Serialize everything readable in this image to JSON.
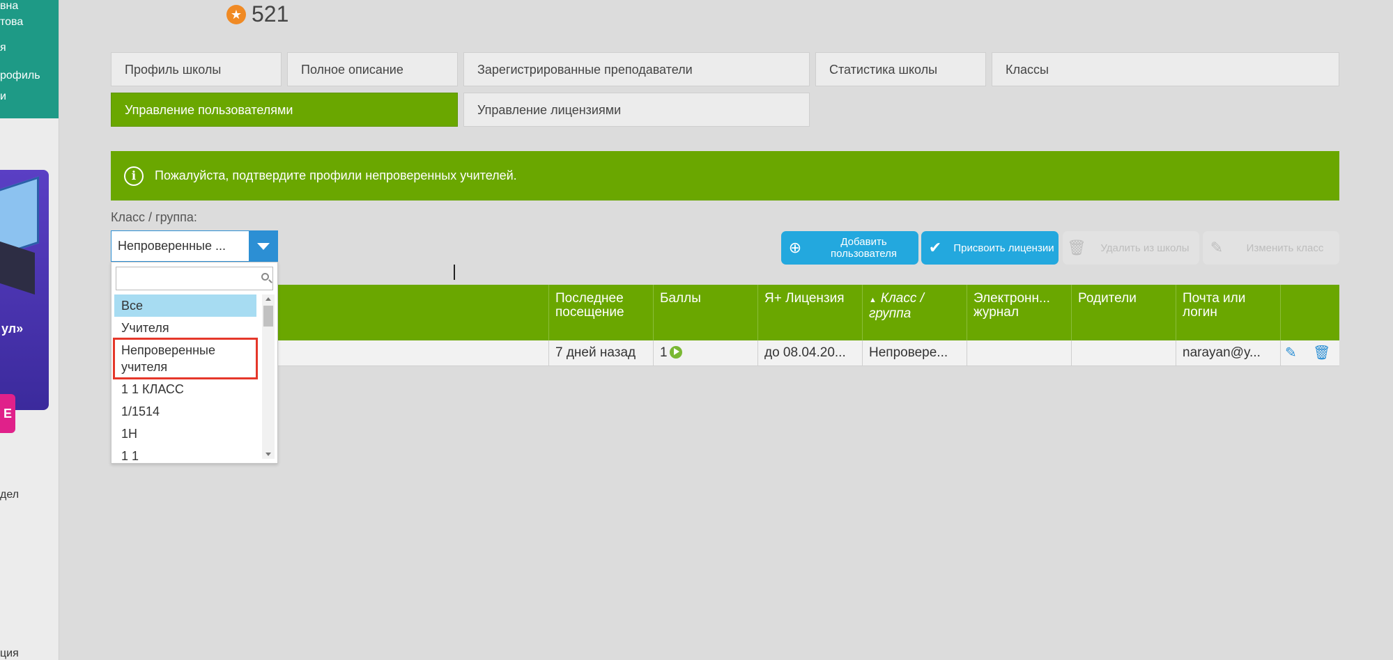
{
  "sidebar": {
    "top_lines": [
      "вна",
      "това",
      "я",
      "рофиль",
      "и"
    ],
    "promo_text": "ул»",
    "promo_button": "Е",
    "bottom_text_1": "дел",
    "bottom_text_2": "ция"
  },
  "header": {
    "score": "521",
    "score_icon": "star-icon"
  },
  "tabs": [
    {
      "label": "Профиль школы"
    },
    {
      "label": "Полное описание"
    },
    {
      "label": "Зарегистрированные преподаватели"
    },
    {
      "label": "Статистика школы"
    },
    {
      "label": "Классы"
    },
    {
      "label": "Управление пользователями"
    },
    {
      "label": "Управление лицензиями"
    }
  ],
  "alert": {
    "text": "Пожалуйста, подтвердите профили непроверенных учителей."
  },
  "filter": {
    "label": "Класс / группа:",
    "selected": "Непроверенные ...",
    "options": [
      "Все",
      "Учителя",
      "Непроверенные учителя",
      "1 1 КЛАСС",
      "1/1514",
      "1Н",
      "1 1"
    ]
  },
  "actions": {
    "add_user": "Добавить пользователя",
    "assign_license": "Присвоить лицензии",
    "remove_from_school": "Удалить из школы",
    "change_class": "Изменить класс"
  },
  "table": {
    "columns": [
      "Последнее посещение",
      "Баллы",
      "Я+ Лицензия",
      "Класс / группа",
      "Электронн... журнал",
      "Родители",
      "Почта или логин"
    ],
    "sort_indicator": "▲",
    "rows": [
      {
        "last_visit": "7 дней назад",
        "points": "1",
        "license": "до 08.04.20...",
        "class_group": "Непровере...",
        "journal": "",
        "parents": "",
        "email": "narayan@y..."
      }
    ]
  },
  "colors": {
    "green": "#6aa700",
    "blue": "#23a8de",
    "highlight": "#e5372a"
  }
}
